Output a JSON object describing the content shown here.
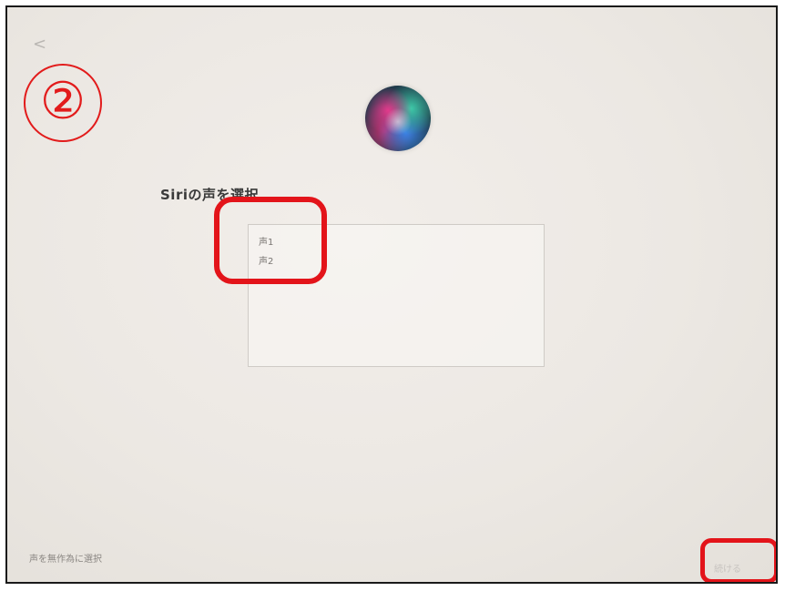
{
  "nav": {
    "back_glyph": "<"
  },
  "annotation": {
    "step_label": "②",
    "highlight_color": "#e3141a"
  },
  "header": {
    "title": "Siriの声を選択"
  },
  "voice_list": {
    "items": [
      "声1",
      "声2"
    ]
  },
  "footer": {
    "random_label": "声を無作為に選択",
    "continue_label": "続ける"
  }
}
